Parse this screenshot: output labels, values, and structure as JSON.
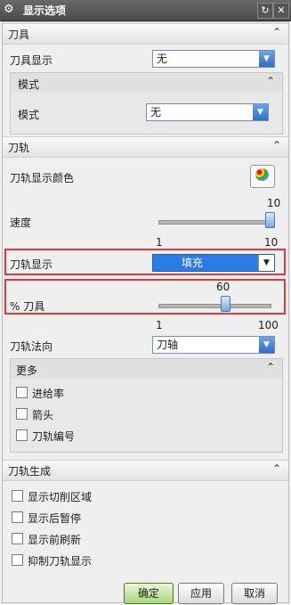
{
  "window": {
    "title": "显示选项",
    "reset_icon": "reset-icon",
    "close_icon": "close-icon"
  },
  "tool": {
    "header": "刀具",
    "display_label": "刀具显示",
    "display_value": "无",
    "mode_panel": {
      "header": "模式",
      "label": "模式",
      "value": "无"
    }
  },
  "path": {
    "header": "刀轨",
    "color_label": "刀轨显示颜色",
    "speed": {
      "label": "速度",
      "value": "10",
      "min": "1",
      "max": "10",
      "fraction": 1.0
    },
    "display_label": "刀轨显示",
    "display_value": "填充",
    "tool_pct": {
      "label": "% 刀具",
      "value": "60",
      "min": "1",
      "max": "100",
      "fraction": 0.6
    },
    "direction_label": "刀轨法向",
    "direction_value": "刀轴",
    "more": {
      "header": "更多",
      "options": [
        "进给率",
        "箭头",
        "刀轨编号"
      ]
    }
  },
  "generate": {
    "header": "刀轨生成",
    "options": [
      "显示切削区域",
      "显示后暂停",
      "显示前刷新",
      "抑制刀轨显示"
    ]
  },
  "buttons": {
    "ok": "确定",
    "apply": "应用",
    "cancel": "取消"
  },
  "colors": {
    "highlight": "#e03a3a",
    "select_fill": "#2b7ce6"
  }
}
